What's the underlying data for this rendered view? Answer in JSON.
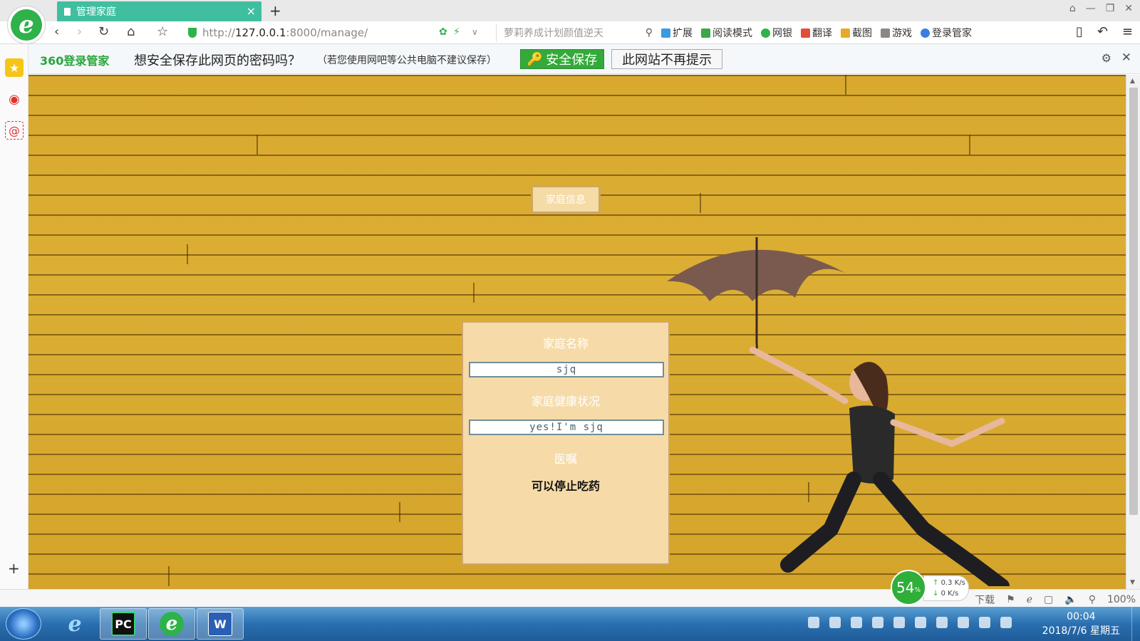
{
  "browser": {
    "tab": {
      "title": "管理家庭",
      "close_icon": "×"
    },
    "new_tab_icon": "+",
    "url": {
      "scheme": "http://",
      "host": "127.0.0.1",
      "rest": ":8000/manage/"
    },
    "search_placeholder": "萝莉养成计划颜值逆天",
    "toolbar": {
      "extensions": "扩展",
      "reading_mode": "阅读模式",
      "bank": "网银",
      "translate": "翻译",
      "screenshot": "截图",
      "games": "游戏",
      "login_manager": "登录管家"
    }
  },
  "password_bar": {
    "brand": "360登录管家",
    "question": "想安全保存此网页的密码吗？",
    "hint": "（若您使用网吧等公共电脑不建议保存）",
    "save_button": "安全保存",
    "never_button": "此网站不再提示"
  },
  "page": {
    "family_info_button": "家庭信息",
    "form": {
      "family_name_label": "家庭名称",
      "family_name_value": "sjq",
      "health_label": "家庭健康状况",
      "health_value": "yes!I'm sjq",
      "advice_label": "医嘱",
      "advice_value": "可以停止吃药"
    }
  },
  "status": {
    "speed_percent": "54",
    "speed_unit": "%",
    "upload": "0.3 K/s",
    "download": "0 K/s",
    "download_label": "下载",
    "zoom": "100%"
  },
  "taskbar": {
    "time": "00:04",
    "date": "2018/7/6 星期五",
    "apps": [
      "internet-explorer",
      "pycharm",
      "360-browser",
      "word"
    ]
  },
  "colors": {
    "tab_active": "#3fbfa0",
    "save_green": "#33aa3a",
    "wall_yellow": "#d8a92e",
    "panel_bg": "#f6dba9"
  }
}
